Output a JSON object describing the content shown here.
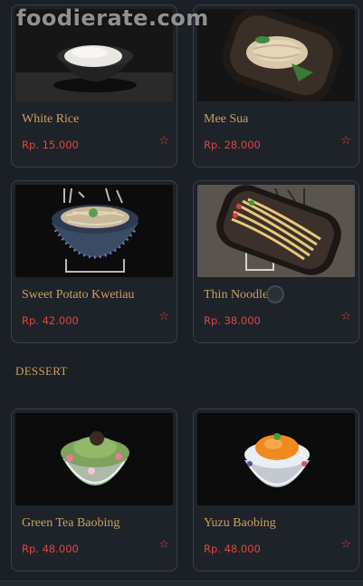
{
  "watermark": "foodierate.com",
  "items_top": [
    {
      "name": "White Rice",
      "price": "Rp. 15.000"
    },
    {
      "name": "Mee Sua",
      "price": "Rp. 28.000"
    },
    {
      "name": "Sweet Potato Kwetiau",
      "price": "Rp. 42.000"
    },
    {
      "name": "Thin Noodle",
      "price": "Rp. 38.000"
    }
  ],
  "section": {
    "dessert": "DESSERT"
  },
  "items_dessert": [
    {
      "name": "Green Tea Baobing",
      "price": "Rp. 48.000"
    },
    {
      "name": "Yuzu Baobing",
      "price": "Rp. 48.000"
    }
  ],
  "colors": {
    "name": "#c9a15d",
    "price": "#e0463e",
    "background": "#1b1f26"
  },
  "icons": {
    "favorite": "star-outline-icon"
  }
}
